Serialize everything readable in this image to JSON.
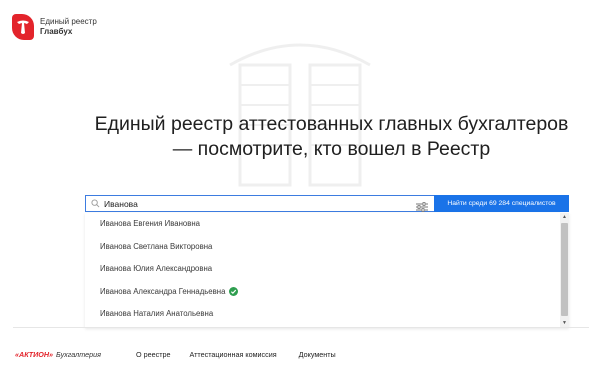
{
  "header": {
    "logo_line1": "Единый реестр",
    "logo_line2": "Главбух",
    "logo_icon": "registry-logo-icon",
    "brand_color": "#e3242b"
  },
  "hero": {
    "title_line1": "Единый реестр аттестованных главных бухгалтеров",
    "title_line2": "— посмотрите, кто вошел в Реестр"
  },
  "search": {
    "value": "Иванова",
    "placeholder": "",
    "button_label": "Найти среди 69 284 специалистов",
    "accent_color": "#1a73e8"
  },
  "suggestions": [
    {
      "name": "Иванова Евгения Ивановна",
      "verified": false
    },
    {
      "name": "Иванова Светлана Викторовна",
      "verified": false
    },
    {
      "name": "Иванова Юлия Александровна",
      "verified": false
    },
    {
      "name": "Иванова Александра Геннадьевна",
      "verified": true
    },
    {
      "name": "Иванова Наталия Анатольевна",
      "verified": false
    }
  ],
  "footer": {
    "brand_main": "«АКТИОН»",
    "brand_sub": "Бухгалтерия",
    "links": [
      "О реестре",
      "Аттестационная комиссия",
      "Документы"
    ]
  }
}
